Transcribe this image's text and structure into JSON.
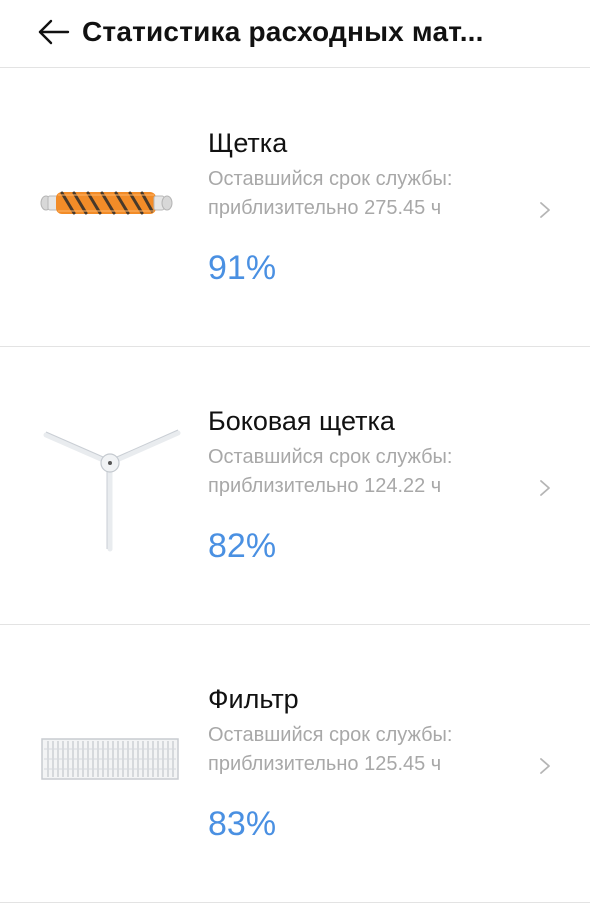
{
  "header": {
    "title": "Статистика расходных мат...",
    "back_icon": "arrow-left-icon"
  },
  "items": [
    {
      "name": "Щетка",
      "remaining_label": "Оставшийся срок службы:",
      "remaining_value": "приблизительно 275.45 ч",
      "percent": "91%",
      "percent_value": 91,
      "image": "main-brush-image"
    },
    {
      "name": "Боковая щетка",
      "remaining_label": "Оставшийся срок службы:",
      "remaining_value": "приблизительно 124.22 ч",
      "percent": "82%",
      "percent_value": 82,
      "image": "side-brush-image"
    },
    {
      "name": "Фильтр",
      "remaining_label": "Оставшийся срок службы:",
      "remaining_value": "приблизительно 125.45 ч",
      "percent": "83%",
      "percent_value": 83,
      "image": "filter-image"
    }
  ],
  "colors": {
    "accent": "#4a90e2",
    "secondary_text": "#a8a8a8",
    "divider": "#e3e3e3",
    "brush_orange": "#f28c28"
  }
}
